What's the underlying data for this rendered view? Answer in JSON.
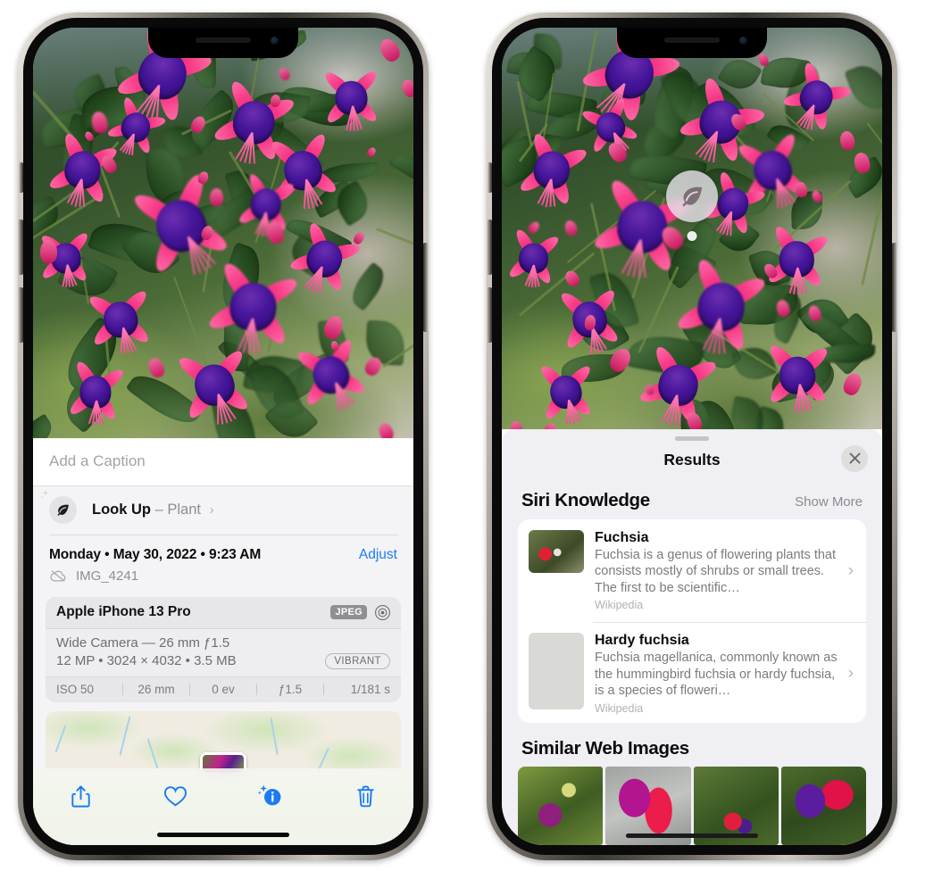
{
  "left_phone": {
    "caption": {
      "placeholder": "Add a Caption"
    },
    "lookup": {
      "icon": "leaf-icon",
      "label": "Look Up",
      "dash": "–",
      "subject": "Plant",
      "chevron": "›"
    },
    "metadata": {
      "date": "Monday • May 30, 2022 • 9:23 AM",
      "adjust_label": "Adjust",
      "cloud_icon": "cloud-slash-icon",
      "filename": "IMG_4241"
    },
    "exif": {
      "device": "Apple iPhone 13 Pro",
      "format_badge": "JPEG",
      "aperture_icon": "aperture-icon",
      "lens": "Wide Camera — 26 mm ƒ1.5",
      "size": "12 MP • 3024 × 4032 • 3.5 MB",
      "style_badge": "VIBRANT",
      "stats": [
        "ISO 50",
        "26 mm",
        "0 ev",
        "ƒ1.5",
        "1/181 s"
      ]
    },
    "toolbar": [
      {
        "name": "share-button",
        "icon": "share-icon",
        "active": false
      },
      {
        "name": "favorite-button",
        "icon": "heart-icon",
        "active": false
      },
      {
        "name": "info-button",
        "icon": "info-sparkle-icon",
        "active": true
      },
      {
        "name": "delete-button",
        "icon": "trash-icon",
        "active": false
      }
    ],
    "accent_color": "#1a7bf5"
  },
  "right_phone": {
    "photo_badge": {
      "icon": "leaf-icon"
    },
    "sheet": {
      "title": "Results",
      "close_icon": "close-icon"
    },
    "siri_knowledge": {
      "title": "Siri Knowledge",
      "action": "Show More",
      "results": [
        {
          "title": "Fuchsia",
          "description": "Fuchsia is a genus of flowering plants that consists mostly of shrubs or small trees. The first to be scientific…",
          "source": "Wikipedia",
          "chevron": "›"
        },
        {
          "title": "Hardy fuchsia",
          "description": "Fuchsia magellanica, commonly known as the hummingbird fuchsia or hardy fuchsia, is a species of floweri…",
          "source": "Wikipedia",
          "chevron": "›"
        }
      ]
    },
    "similar_web_images": {
      "title": "Similar Web Images",
      "count": 4
    }
  }
}
